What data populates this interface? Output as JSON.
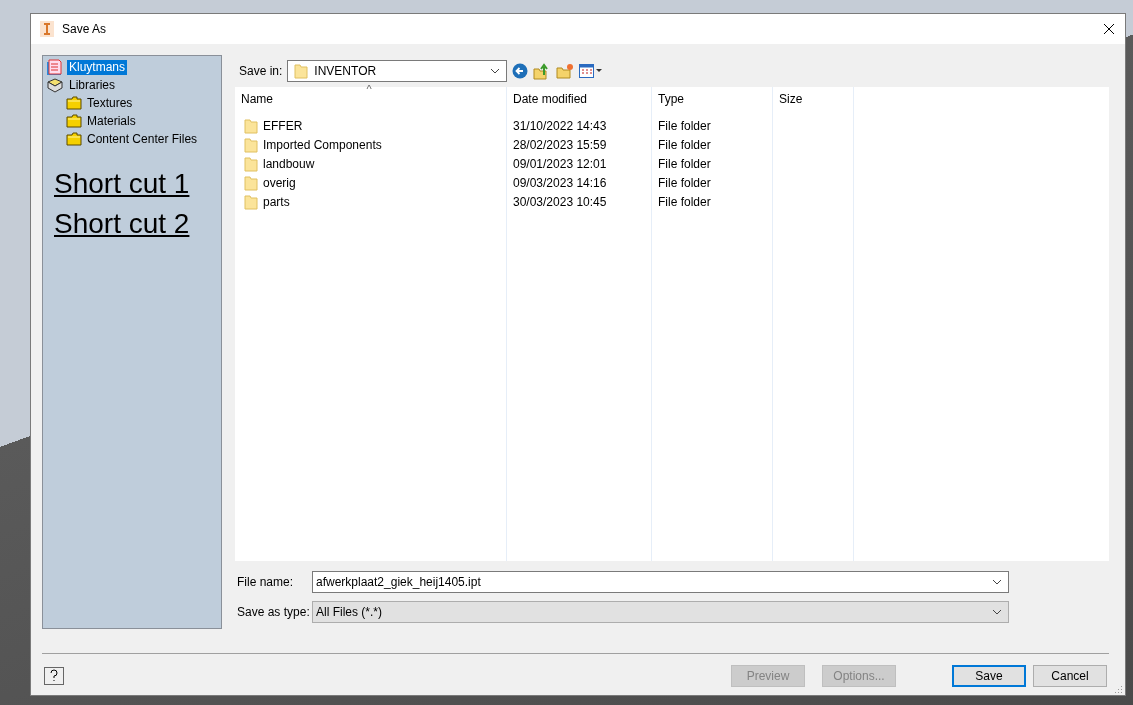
{
  "window": {
    "title": "Save As"
  },
  "sidebar": {
    "items": [
      {
        "label": "Kluytmans",
        "kind": "project",
        "selected": true
      },
      {
        "label": "Libraries",
        "kind": "library",
        "selected": false,
        "children": [
          {
            "label": "Textures",
            "kind": "folder",
            "selected": false
          },
          {
            "label": "Materials",
            "kind": "folder",
            "selected": false
          },
          {
            "label": "Content Center Files",
            "kind": "folder",
            "selected": false
          }
        ]
      }
    ],
    "shortcuts": [
      "Short cut 1",
      "Short cut 2"
    ]
  },
  "save_in": {
    "label": "Save in:",
    "value": "INVENTOR"
  },
  "table": {
    "columns": [
      {
        "label": "Name",
        "sorted": true
      },
      {
        "label": "Date modified",
        "sorted": false
      },
      {
        "label": "Type",
        "sorted": false
      },
      {
        "label": "Size",
        "sorted": false
      }
    ],
    "sort_indicator": "^",
    "rows": [
      {
        "name": "EFFER",
        "date": "31/10/2022 14:43",
        "type": "File folder"
      },
      {
        "name": "Imported Components",
        "date": "28/02/2023 15:59",
        "type": "File folder"
      },
      {
        "name": "landbouw",
        "date": "09/01/2023 12:01",
        "type": "File folder"
      },
      {
        "name": "overig",
        "date": "09/03/2023 14:16",
        "type": "File folder"
      },
      {
        "name": "parts",
        "date": "30/03/2023 10:45",
        "type": "File folder"
      }
    ]
  },
  "file_name": {
    "label": "File name:",
    "value": "afwerkplaat2_giek_heij1405.ipt"
  },
  "save_as_type": {
    "label": "Save as type:",
    "value": "All Files (*.*)",
    "disabled": true
  },
  "buttons": [
    {
      "label": "Preview",
      "disabled": true,
      "default": false
    },
    {
      "label": "Options...",
      "disabled": true,
      "default": false
    },
    {
      "label": "Save",
      "disabled": false,
      "default": true
    },
    {
      "label": "Cancel",
      "disabled": false,
      "default": false
    }
  ]
}
